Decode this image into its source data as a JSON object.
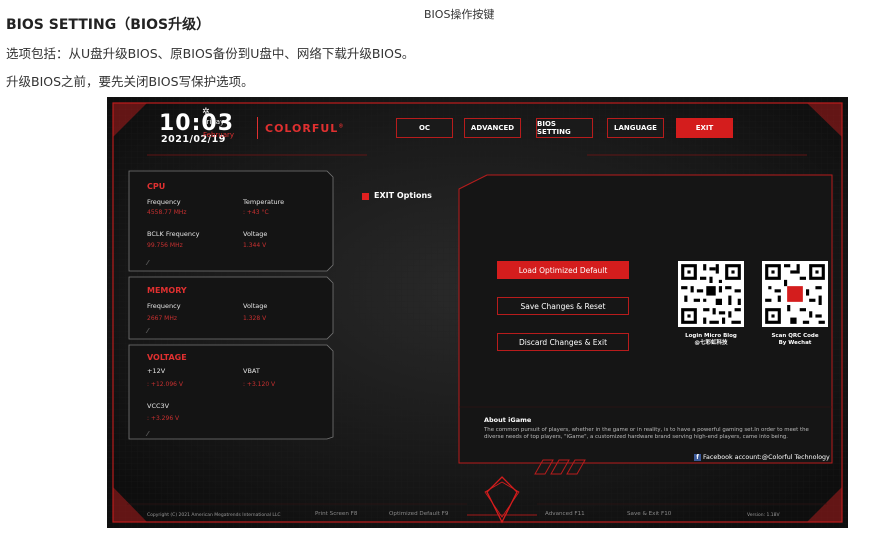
{
  "doc": {
    "top_caption": "BIOS操作按键",
    "title": "BIOS SETTING（BIOS升级）",
    "line1": "选项包括：从U盘升级BIOS、原BIOS备份到U盘中、网络下载升级BIOS。",
    "line2": "升级BIOS之前，要先关闭BIOS写保护选项。"
  },
  "bios": {
    "header": {
      "time": "10:03",
      "date": "2021/02/19",
      "day": "Friday",
      "month": "February",
      "brand": "COLORFUL",
      "brand_mark": "®"
    },
    "nav": [
      {
        "label": "OC",
        "active": false
      },
      {
        "label": "ADVANCED",
        "active": false
      },
      {
        "label": "BIOS SETTING",
        "active": false
      },
      {
        "label": "LANGUAGE",
        "active": false
      },
      {
        "label": "EXIT",
        "active": true
      }
    ],
    "cpu": {
      "title": "CPU",
      "frequency_label": "Frequency",
      "frequency_value": "4558.77 MHz",
      "temperature_label": "Temperature",
      "temperature_value": ": +43 °C",
      "bclk_label": "BCLK Frequency",
      "bclk_value": "99.756 MHz",
      "voltage_label": "Voltage",
      "voltage_value": "1.344 V"
    },
    "memory": {
      "title": "MEMORY",
      "frequency_label": "Frequency",
      "frequency_value": "2667 MHz",
      "voltage_label": "Voltage",
      "voltage_value": "1.328 V"
    },
    "voltage": {
      "title": "VOLTAGE",
      "v12_label": "+12V",
      "v12_value": ": +12.096 V",
      "vbat_label": "VBAT",
      "vbat_value": ": +3.120 V",
      "vcc3v_label": "VCC3V",
      "vcc3v_value": ": +3.296 V"
    },
    "exit_section": {
      "title": "EXIT Options",
      "options": [
        {
          "label": "Load Optimized Default",
          "selected": true
        },
        {
          "label": "Save Changes & Reset",
          "selected": false
        },
        {
          "label": "Discard Changes & Exit",
          "selected": false
        }
      ]
    },
    "qr": {
      "left_caption_1": "Login Micro Blog",
      "left_caption_2": "@七彩虹科技",
      "right_caption_1": "Scan QRC Code",
      "right_caption_2": "By Wechat"
    },
    "about": {
      "title": "About iGame",
      "text": "The common pursuit of players, whether in the game or in reality, is to have a powerful gaming set.In order to meet the diverse needs of top players, \"iGame\", a customized hardware brand serving high-end players, came into being.",
      "facebook_icon": "f",
      "facebook": "Facebook account:@Colorful Technology"
    },
    "footer": {
      "copyright": "Copyright (C) 2021 American Megatrends International LLC",
      "print_screen": "Print Screen F8",
      "optimized_default": "Optimized Default F9",
      "advanced": "Advanced F11",
      "save_exit": "Save & Exit F10",
      "version": "Version: 1.18V"
    },
    "colors": {
      "accent_red": "#d41d1d",
      "background": "#141414",
      "value_red": "#c83030"
    }
  }
}
